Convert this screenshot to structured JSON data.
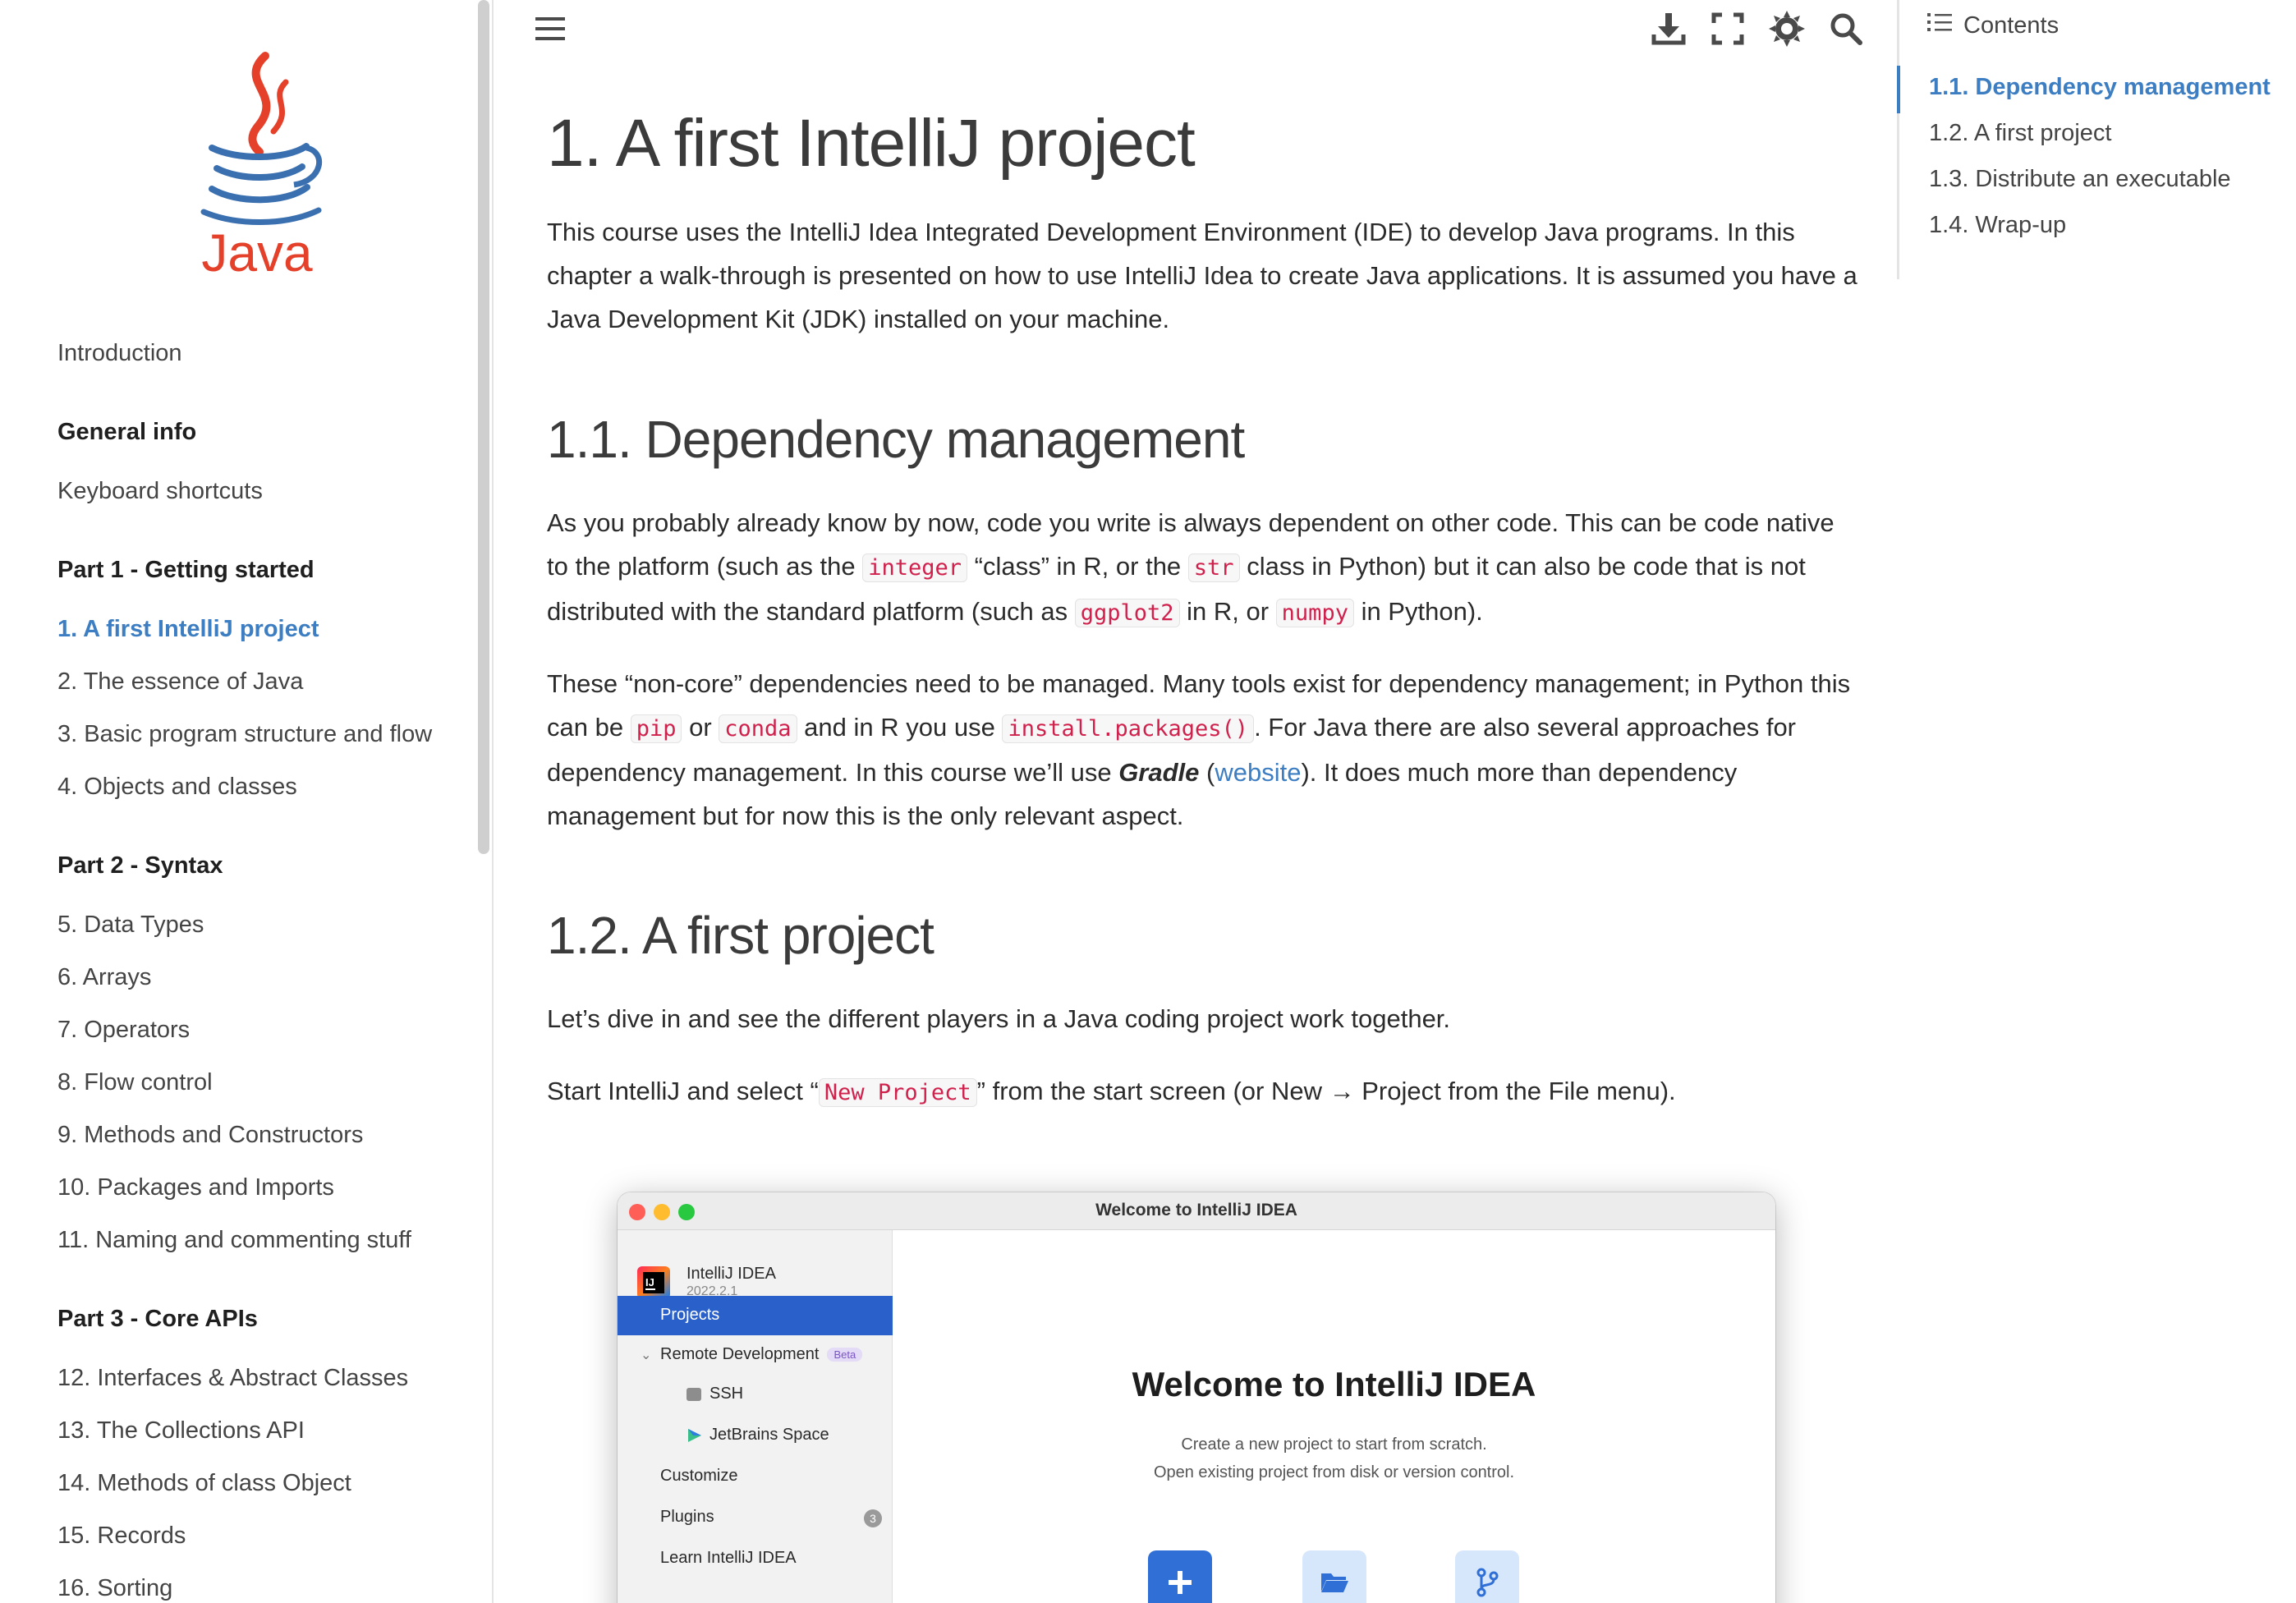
{
  "sidebar": {
    "logo_text": "Java",
    "items": [
      {
        "label": "Introduction",
        "type": "link"
      },
      {
        "label": "General info",
        "type": "header"
      },
      {
        "label": "Keyboard shortcuts",
        "type": "link"
      },
      {
        "label": "Part 1 - Getting started",
        "type": "header"
      },
      {
        "label": "1. A first IntelliJ project",
        "type": "active"
      },
      {
        "label": "2. The essence of Java",
        "type": "link"
      },
      {
        "label": "3. Basic program structure and flow",
        "type": "link"
      },
      {
        "label": "4. Objects and classes",
        "type": "link"
      },
      {
        "label": "Part 2 - Syntax",
        "type": "header"
      },
      {
        "label": "5. Data Types",
        "type": "link"
      },
      {
        "label": "6. Arrays",
        "type": "link"
      },
      {
        "label": "7. Operators",
        "type": "link"
      },
      {
        "label": "8. Flow control",
        "type": "link"
      },
      {
        "label": "9. Methods and Constructors",
        "type": "link"
      },
      {
        "label": "10. Packages and Imports",
        "type": "link"
      },
      {
        "label": "11. Naming and commenting stuff",
        "type": "link"
      },
      {
        "label": "Part 3 - Core APIs",
        "type": "header"
      },
      {
        "label": "12. Interfaces & Abstract Classes",
        "type": "link"
      },
      {
        "label": "13. The Collections API",
        "type": "link"
      },
      {
        "label": "14. Methods of class Object",
        "type": "link"
      },
      {
        "label": "15. Records",
        "type": "link"
      },
      {
        "label": "16. Sorting",
        "type": "link"
      }
    ]
  },
  "toolbar": {
    "icons": [
      "menu-icon",
      "download-icon",
      "fullscreen-icon",
      "theme-icon",
      "search-icon"
    ]
  },
  "main": {
    "title": "1. A first IntelliJ project",
    "intro": "This course uses the IntelliJ Idea Integrated Development Environment (IDE) to develop Java programs. In this chapter a walk-through is presented on how to use IntelliJ Idea to create Java applications. It is assumed you have a Java Development Kit (JDK) installed on your machine.",
    "s1": {
      "heading": "1.1. Dependency management",
      "p1_a": "As you probably already know by now, code you write is always dependent on other code. This can be code native to the platform (such as the ",
      "p1_code1": "integer",
      "p1_b": " “class” in R, or the ",
      "p1_code2": "str",
      "p1_c": " class in Python) but it can also be code that is not distributed with the standard platform (such as ",
      "p1_code3": "ggplot2",
      "p1_d": " in R, or ",
      "p1_code4": "numpy",
      "p1_e": " in Python).",
      "p2_a": "These “non-core” dependencies need to be managed. Many tools exist for dependency management; in Python this can be ",
      "p2_code1": "pip",
      "p2_b": " or ",
      "p2_code2": "conda",
      "p2_c": " and in R you use ",
      "p2_code3": "install.packages()",
      "p2_d": ". For Java there are also several approaches for dependency management. In this course we’ll use ",
      "p2_em": "Gradle",
      "p2_e": " (",
      "p2_link": "website",
      "p2_f": "). It does much more than dependency management but for now this is the only relevant aspect."
    },
    "s2": {
      "heading": "1.2. A first project",
      "p1": "Let’s dive in and see the different players in a Java coding project work together.",
      "p2_a": "Start IntelliJ and select “",
      "p2_code": "New Project",
      "p2_b": "” from the start screen (or New → Project from the File menu)."
    }
  },
  "toc": {
    "title": "Contents",
    "items": [
      {
        "label": "1.1. Dependency management",
        "active": true
      },
      {
        "label": "1.2. A first project",
        "active": false
      },
      {
        "label": "1.3. Distribute an executable",
        "active": false
      },
      {
        "label": "1.4. Wrap-up",
        "active": false
      }
    ]
  },
  "intellij": {
    "window_title": "Welcome to IntelliJ IDEA",
    "app_name": "IntelliJ IDEA",
    "app_version": "2022.2.1",
    "nav": {
      "projects": "Projects",
      "remote": "Remote Development",
      "beta": "Beta",
      "ssh": "SSH",
      "space": "JetBrains Space",
      "customize": "Customize",
      "plugins": "Plugins",
      "plugins_badge": "3",
      "learn": "Learn IntelliJ IDEA"
    },
    "welcome": "Welcome to IntelliJ IDEA",
    "sub1": "Create a new project to start from scratch.",
    "sub2": "Open existing project from disk or version control.",
    "colors": {
      "selection": "#2a60c9",
      "action_primary": "#2f6fd6",
      "action_secondary": "#d6e6fb"
    }
  }
}
